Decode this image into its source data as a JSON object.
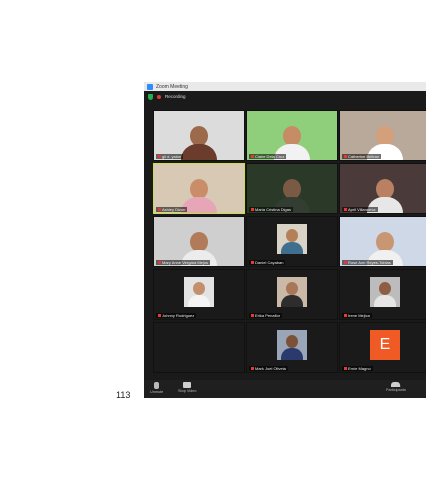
{
  "page": {
    "number": "113"
  },
  "window": {
    "title": "Zoom Meeting"
  },
  "topbar": {
    "recording_label": "Recording"
  },
  "tiles": [
    {
      "name": "gil d. yalon",
      "bg": "#dcdcdc",
      "skin": "#9c6a4a",
      "shirt": "#6b3b2b",
      "style": "person"
    },
    {
      "name": "Claire Dela Cruz",
      "bg": "#8fce7a",
      "skin": "#c58c66",
      "shirt": "#f2f2f2",
      "style": "person"
    },
    {
      "name": "Catherine Beltran",
      "bg": "#b9a99a",
      "skin": "#d3a07b",
      "shirt": "#ffffff",
      "style": "person"
    },
    {
      "name": "Ashley Dizon",
      "bg": "#d8c9b4",
      "skin": "#c98e69",
      "shirt": "#e6a6b8",
      "style": "person",
      "active": true
    },
    {
      "name": "Maria Cristina Digas",
      "bg": "#2b3a28",
      "skin": "#7a5a44",
      "shirt": "#343d31",
      "style": "person"
    },
    {
      "name": "April Villanueva",
      "bg": "#4a3a3a",
      "skin": "#b98162",
      "shirt": "#e7e7e7",
      "style": "person"
    },
    {
      "name": "Mary Anne Vergara Mejos",
      "bg": "#cfcfcf",
      "skin": "#b17b59",
      "shirt": "#ececec",
      "style": "person"
    },
    {
      "name": "Daniel Cayaban",
      "bg": "#1a1a1a",
      "skin": "#b38058",
      "shirt": "#3e6f8f",
      "style": "thumb",
      "thumb_bg": "#d9d2c7"
    },
    {
      "name": "Rose Ann Reyes-Tobias",
      "bg": "#cfd8e6",
      "skin": "#c99674",
      "shirt": "#f0f0f0",
      "style": "person"
    },
    {
      "name": "Johnny Rodriguez",
      "bg": "#1a1a1a",
      "skin": "#c48f6b",
      "shirt": "#f4f4f4",
      "style": "thumb",
      "thumb_bg": "#e3e3e3"
    },
    {
      "name": "Erika Penaflor",
      "bg": "#1a1a1a",
      "skin": "#a97658",
      "shirt": "#2d2d2d",
      "style": "thumb",
      "thumb_bg": "#c9b9a6"
    },
    {
      "name": "Irene Mejica",
      "bg": "#1a1a1a",
      "skin": "#8e5d43",
      "shirt": "#e5e5e5",
      "style": "thumb",
      "thumb_bg": "#bcbcbc"
    },
    {
      "name": "",
      "bg": "#1a1a1a",
      "style": "empty"
    },
    {
      "name": "Mark Joel Oliveta",
      "bg": "#1a1a1a",
      "skin": "#7b5238",
      "shirt": "#2b3a6d",
      "style": "thumb",
      "thumb_bg": "#9aa6b8"
    },
    {
      "name": "Ernie Magno",
      "bg": "#1a1a1a",
      "style": "letter",
      "letter": "E",
      "accent": "#f05a24"
    }
  ],
  "toolbar": {
    "unmute_label": "Unmute",
    "stop_video_label": "Stop Video",
    "participants_label": "Participants",
    "participants_count": "28"
  }
}
